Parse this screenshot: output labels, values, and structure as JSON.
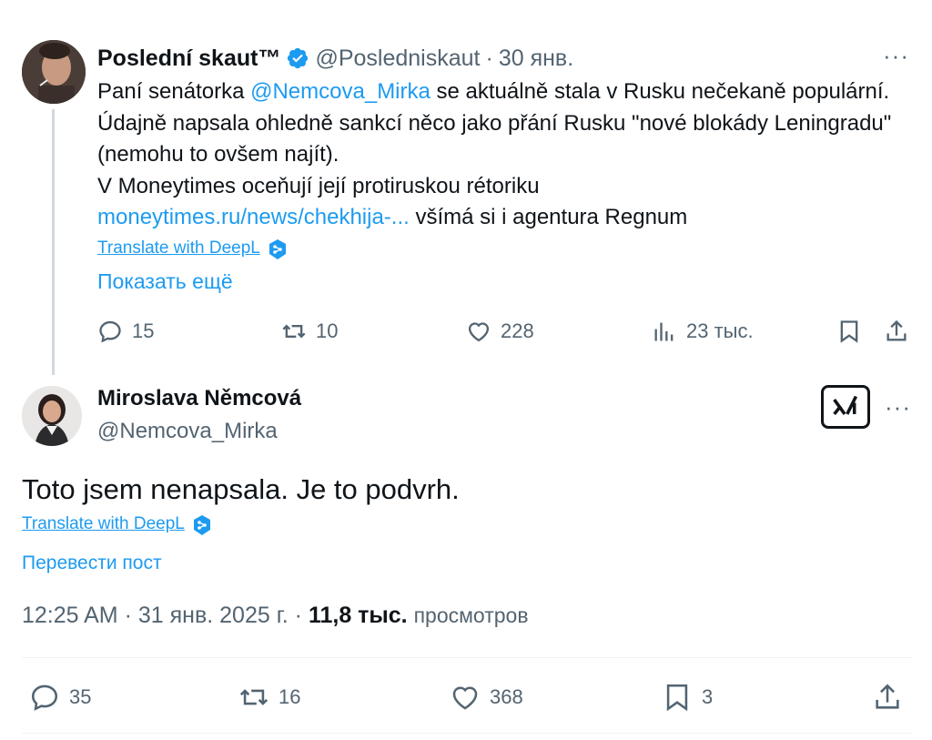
{
  "parent": {
    "author_name": "Poslední skaut™",
    "handle": "@Posledniskaut",
    "separator": "·",
    "date": "30 янв.",
    "more": "···",
    "text_before_mention": "Paní senátorka ",
    "mention": "@Nemcova_Mirka",
    "text_after_mention": " se aktuálně stala v Rusku nečekaně populární. Údajně napsala ohledně sankcí něco jako přání Rusku \"nové blokády Leningradu\" (nemohu to ovšem najít).",
    "text_line2": "V Moneytimes oceňují její protiruskou rétoriku",
    "link": "moneytimes.ru/news/chekhija-...",
    "text_after_link": " všímá si i agentura Regnum",
    "translate": "Translate with DeepL",
    "show_more": "Показать ещё",
    "stats": {
      "replies": "15",
      "reposts": "10",
      "likes": "228",
      "views": "23 тыс."
    }
  },
  "reply": {
    "author_name": "Miroslava Němcová",
    "handle": "@Nemcova_Mirka",
    "more": "···",
    "text": "Toto jsem nenapsala. Je to podvrh.",
    "translate": "Translate with DeepL",
    "translate_post": "Перевести пост",
    "time": "12:25 AM",
    "sep": "·",
    "date": "31 янв. 2025 г.",
    "views_count": "11,8 тыс.",
    "views_label": "просмотров",
    "stats": {
      "replies": "35",
      "reposts": "16",
      "likes": "368",
      "bookmarks": "3"
    }
  },
  "colors": {
    "accent": "#1d9bf0",
    "text": "#0f1419",
    "secondary": "#536471",
    "deepl": "#1d9bf0"
  },
  "icons": [
    "verified-badge-icon",
    "more-icon",
    "reply-icon",
    "repost-icon",
    "like-icon",
    "views-icon",
    "bookmark-icon",
    "share-icon",
    "deepl-icon",
    "grok-icon"
  ]
}
